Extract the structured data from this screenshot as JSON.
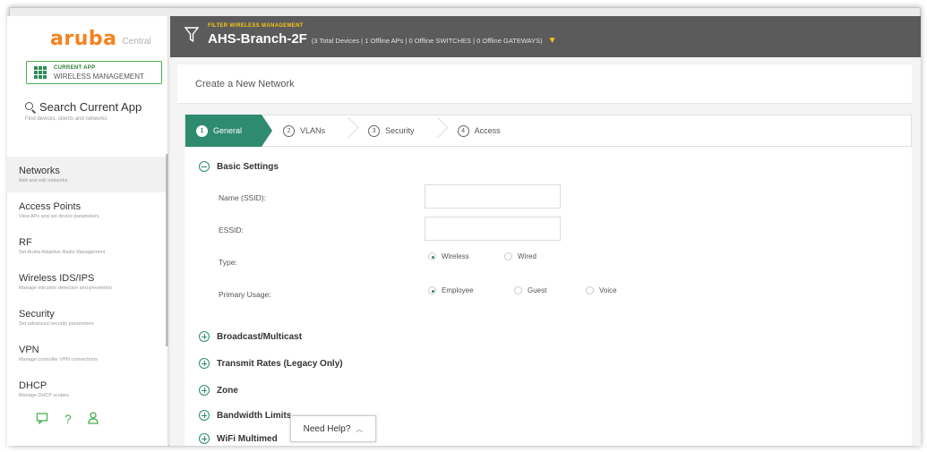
{
  "brand": {
    "logo": "aruba",
    "product": "Central"
  },
  "current_app": {
    "label": "CURRENT APP",
    "name": "WIRELESS MANAGEMENT"
  },
  "search": {
    "title": "Search Current App",
    "subtitle": "Find devices, clients and networks"
  },
  "nav": {
    "items": [
      {
        "title": "Networks",
        "subtitle": "Add and edit networks"
      },
      {
        "title": "Access Points",
        "subtitle": "View APs and set device parameters"
      },
      {
        "title": "RF",
        "subtitle": "Set Aruba Adaptive Radio Management"
      },
      {
        "title": "Wireless IDS/IPS",
        "subtitle": "Manage intrusion detection and prevention"
      },
      {
        "title": "Security",
        "subtitle": "Set advanced security parameters"
      },
      {
        "title": "VPN",
        "subtitle": "Manage controller VPN connections"
      },
      {
        "title": "DHCP",
        "subtitle": "Manage DHCP scopes"
      }
    ]
  },
  "footer_icons": {
    "chat": "chat-icon",
    "help": "help-icon",
    "user": "user-icon",
    "help_glyph": "?"
  },
  "header": {
    "filter_label": "FILTER WIRELESS MANAGEMENT",
    "title": "AHS-Branch-2F",
    "summary": "(3 Total Devices | 1 Offline APs | 0 Offline SWITCHES | 0 Offline GATEWAYS)"
  },
  "page": {
    "title": "Create a New Network"
  },
  "wizard": {
    "steps": [
      {
        "num": "1",
        "label": "General"
      },
      {
        "num": "2",
        "label": "VLANs"
      },
      {
        "num": "3",
        "label": "Security"
      },
      {
        "num": "4",
        "label": "Access"
      }
    ]
  },
  "form": {
    "basic_settings": "Basic Settings",
    "name_label": "Name (SSID):",
    "essid_label": "ESSID:",
    "type_label": "Type:",
    "type_options": [
      "Wireless",
      "Wired"
    ],
    "usage_label": "Primary Usage:",
    "usage_options": [
      "Employee",
      "Guest",
      "Voice"
    ],
    "sections": [
      "Broadcast/Multicast",
      "Transmit Rates (Legacy Only)",
      "Zone",
      "Bandwidth Limits",
      "WiFi Multimed"
    ]
  },
  "help": {
    "label": "Need Help?"
  },
  "colors": {
    "accent": "#2e8b6f",
    "brand": "#f58220",
    "header": "#5b5b5b",
    "highlight": "#f5c518"
  }
}
